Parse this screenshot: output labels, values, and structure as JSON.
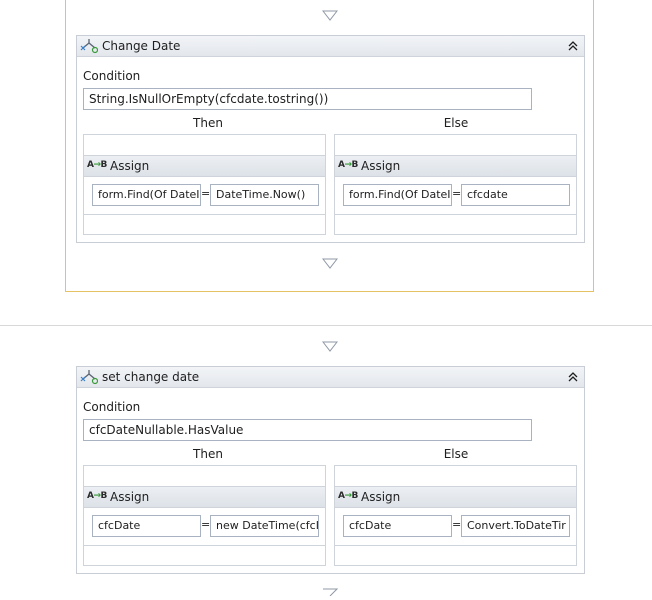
{
  "activities": [
    {
      "title": "Change Date",
      "condition_label": "Condition",
      "condition": "String.IsNullOrEmpty(cfcdate.tostring())",
      "then_label": "Then",
      "else_label": "Else",
      "then_assign": {
        "title": "Assign",
        "to": "form.Find(Of DateI",
        "equals": "=",
        "value": "DateTime.Now()"
      },
      "else_assign": {
        "title": "Assign",
        "to": "form.Find(Of DateI",
        "equals": "=",
        "value": "cfcdate"
      }
    },
    {
      "title": "set change date",
      "condition_label": "Condition",
      "condition": "cfcDateNullable.HasValue",
      "then_label": "Then",
      "else_label": "Else",
      "then_assign": {
        "title": "Assign",
        "to": "cfcDate",
        "equals": "=",
        "value": "new DateTime(cfcI"
      },
      "else_assign": {
        "title": "Assign",
        "to": "cfcDate",
        "equals": "=",
        "value": "Convert.ToDateTir"
      }
    }
  ],
  "icons": {
    "if_activity": "if-activity-icon",
    "assign": "assign-icon",
    "collapse": "collapse-chevron-icon",
    "drop_arrow": "drop-arrow-icon"
  },
  "colors": {
    "selection_border": "#e5c365",
    "header_bg": "#e3e7ec",
    "field_border": "#a8b2c0"
  }
}
